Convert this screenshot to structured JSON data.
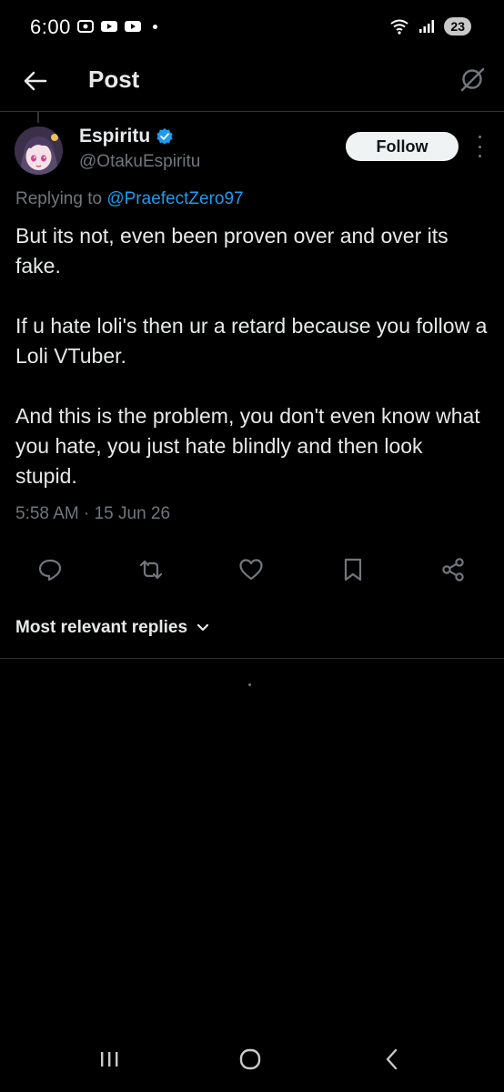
{
  "status_bar": {
    "time": "6:00",
    "battery": "23"
  },
  "header": {
    "title": "Post"
  },
  "post": {
    "author": {
      "display_name": "Espiritu",
      "handle": "@OtakuEspiritu",
      "verified": true
    },
    "follow_label": "Follow",
    "replying_prefix": "Replying to ",
    "replying_to": "@PraefectZero97",
    "paragraphs": [
      "But its not, even been proven over and over its fake.",
      "If u hate loli's then ur a retard because you follow a Loli VTuber.",
      "And this is the problem, you don't even know what you hate, you just hate blindly and then look stupid."
    ],
    "timestamp": "5:58 AM · 15 Jun 26"
  },
  "actions": [
    {
      "icon": "reply-icon"
    },
    {
      "icon": "repost-icon"
    },
    {
      "icon": "like-icon"
    },
    {
      "icon": "bookmark-icon"
    },
    {
      "icon": "share-icon"
    }
  ],
  "replies": {
    "sort_label": "Most relevant replies"
  },
  "colors": {
    "background": "#000000",
    "text": "#e7e9ea",
    "muted": "#71767b",
    "accent": "#1d9bf0",
    "divider": "#2f3336"
  }
}
